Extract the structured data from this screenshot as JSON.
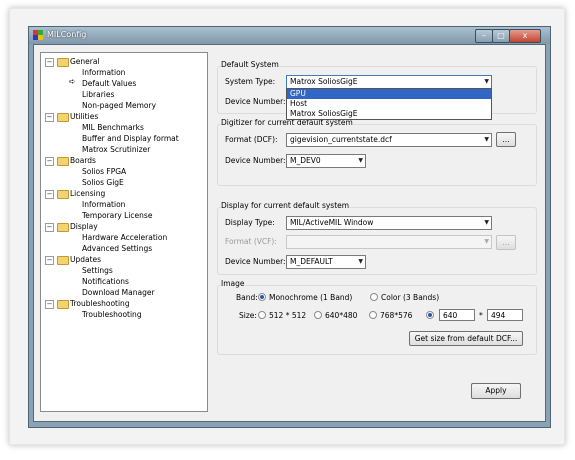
{
  "window": {
    "title": "MILConfig",
    "buttons": {
      "min": "–",
      "max": "□",
      "close": "x"
    }
  },
  "tree": {
    "expander_symbol": "−",
    "current_marker": "➪",
    "nodes": [
      {
        "label": "General",
        "level": 0
      },
      {
        "label": "Information",
        "level": 1
      },
      {
        "label": "Default Values",
        "level": 1
      },
      {
        "label": "Libraries",
        "level": 1
      },
      {
        "label": "Non-paged Memory",
        "level": 1
      },
      {
        "label": "Utilities",
        "level": 0
      },
      {
        "label": "MIL Benchmarks",
        "level": 1
      },
      {
        "label": "Buffer and Display format",
        "level": 1
      },
      {
        "label": "Matrox Scrutinizer",
        "level": 1
      },
      {
        "label": "Boards",
        "level": 0
      },
      {
        "label": "Solios FPGA",
        "level": 1
      },
      {
        "label": "Solios GigE",
        "level": 1
      },
      {
        "label": "Licensing",
        "level": 0
      },
      {
        "label": "Information",
        "level": 1
      },
      {
        "label": "Temporary License",
        "level": 1
      },
      {
        "label": "Display",
        "level": 0
      },
      {
        "label": "Hardware Acceleration",
        "level": 1
      },
      {
        "label": "Advanced Settings",
        "level": 1
      },
      {
        "label": "Updates",
        "level": 0
      },
      {
        "label": "Settings",
        "level": 1
      },
      {
        "label": "Notifications",
        "level": 1
      },
      {
        "label": "Download Manager",
        "level": 1
      },
      {
        "label": "Troubleshooting",
        "level": 0
      },
      {
        "label": "Troubleshooting",
        "level": 1
      }
    ]
  },
  "default_system": {
    "group_label": "Default System",
    "system_type_label": "System Type:",
    "system_type_value": "Matrox SoliosGigE",
    "dropdown_options": [
      "GPU",
      "Host",
      "Matrox SoliosGigE"
    ],
    "device_number_label": "Device Number:"
  },
  "digitizer": {
    "group_label": "Digitizer for current default system",
    "format_label": "Format (DCF):",
    "format_value": "gigevision_currentstate.dcf",
    "browse_label": "...",
    "device_number_label": "Device Number:",
    "device_number_value": "M_DEV0"
  },
  "display": {
    "group_label": "Display for current default system",
    "display_type_label": "Display Type:",
    "display_type_value": "MIL/ActiveMIL Window",
    "format_label": "Format (VCF):",
    "format_value": "",
    "browse_label": "...",
    "device_number_label": "Device Number:",
    "device_number_value": "M_DEFAULT"
  },
  "image": {
    "group_label": "Image",
    "band_label": "Band:",
    "band_mono": "Monochrome (1 Band)",
    "band_color": "Color (3 Bands)",
    "size_label": "Size:",
    "size_512": "512 * 512",
    "size_640": "640*480",
    "size_768": "768*576",
    "width": "640",
    "times": "*",
    "height": "494",
    "get_size_button": "Get size from default DCF..."
  },
  "apply_button": "Apply"
}
